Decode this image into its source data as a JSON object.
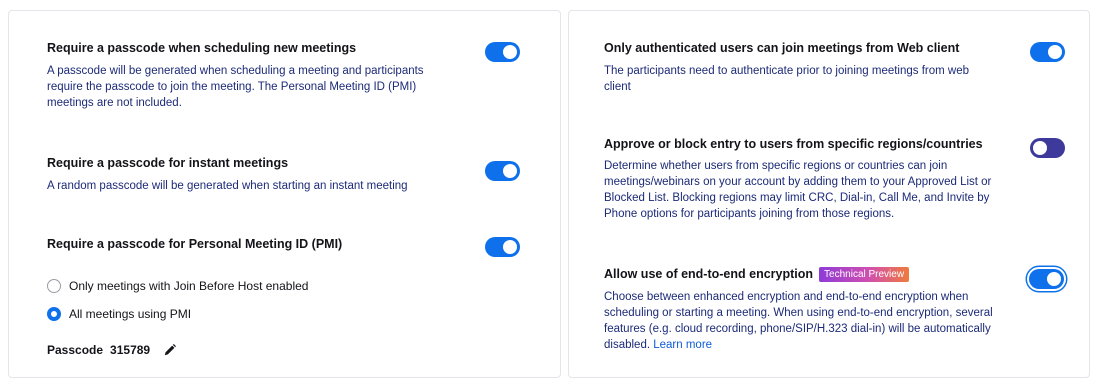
{
  "left": {
    "passcode_scheduling": {
      "title": "Require a passcode when scheduling new meetings",
      "description": "A passcode will be generated when scheduling a meeting and participants require the passcode to join the meeting. The Personal Meeting ID (PMI) meetings are not included.",
      "enabled": true
    },
    "passcode_instant": {
      "title": "Require a passcode for instant meetings",
      "description": "A random passcode will be generated when starting an instant meeting",
      "enabled": true
    },
    "passcode_pmi": {
      "title": "Require a passcode for Personal Meeting ID (PMI)",
      "enabled": true,
      "options": [
        {
          "label": "Only meetings with Join Before Host enabled",
          "selected": false
        },
        {
          "label": "All meetings using PMI",
          "selected": true
        }
      ],
      "passcode_label": "Passcode",
      "passcode_value": "315789",
      "edit_icon": "pencil-icon"
    }
  },
  "right": {
    "web_auth": {
      "title": "Only authenticated users can join meetings from Web client",
      "description": "The participants need to authenticate prior to joining meetings from web client",
      "enabled": true
    },
    "regions": {
      "title": "Approve or block entry to users from specific regions/countries",
      "description": "Determine whether users from specific regions or countries can join meetings/webinars on your account by adding them to your Approved List or Blocked List. Blocking regions may limit CRC, Dial-in, Call Me, and Invite by Phone options for participants joining from those regions.",
      "enabled": false
    },
    "e2e": {
      "title": "Allow use of end-to-end encryption",
      "badge": "Technical Preview",
      "description": "Choose between enhanced encryption and end-to-end encryption when scheduling or starting a meeting. When using end-to-end encryption, several features (e.g. cloud recording, phone/SIP/H.323 dial-in) will be automatically disabled.",
      "learn_more": "Learn more",
      "enabled": true
    }
  },
  "colors": {
    "toggle_on": "#0e71eb",
    "toggle_off": "#3e3a9c",
    "description_text": "#1c2a78",
    "badge_gradient": [
      "#8e3bd8",
      "#f07a3c"
    ]
  }
}
